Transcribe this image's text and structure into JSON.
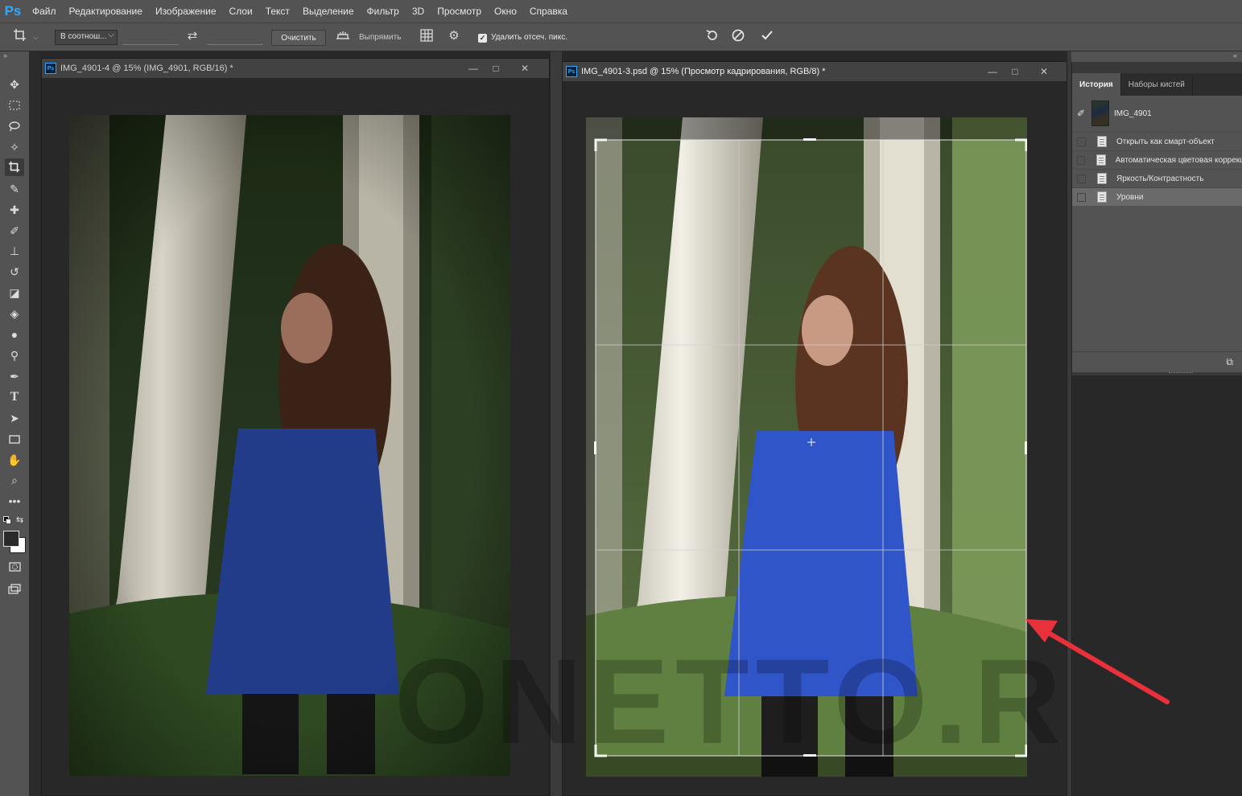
{
  "app": {
    "logo": "Ps"
  },
  "menu": [
    "Файл",
    "Редактирование",
    "Изображение",
    "Слои",
    "Текст",
    "Выделение",
    "Фильтр",
    "3D",
    "Просмотр",
    "Окно",
    "Справка"
  ],
  "options": {
    "crop_icon": "crop-icon",
    "ratio_label": "В соотнош...",
    "clear_label": "Очистить",
    "straighten_label": "Выпрямить",
    "delete_cropped_label": "Удалить отсеч. пикс.",
    "delete_cropped_checked": true
  },
  "tools": [
    "move-icon",
    "marquee-icon",
    "lasso-icon",
    "magic-wand-icon",
    "crop-icon",
    "eyedropper-icon",
    "healing-brush-icon",
    "brush-icon",
    "clone-stamp-icon",
    "history-brush-icon",
    "eraser-icon",
    "paint-bucket-icon",
    "blur-icon",
    "dodge-icon",
    "pen-icon",
    "type-icon",
    "path-selection-icon",
    "rectangle-icon",
    "hand-icon",
    "zoom-icon",
    "more-tools-icon"
  ],
  "documents": [
    {
      "title": "IMG_4901-4 @ 15% (IMG_4901, RGB/16) *",
      "active": false
    },
    {
      "title": "IMG_4901-3.psd @ 15% (Просмотр кадрирования, RGB/8) *",
      "active": true
    }
  ],
  "window_controls": {
    "minimize": "—",
    "maximize": "□",
    "close": "✕"
  },
  "watermark": "ONETTO.RU",
  "panels": {
    "tabs": [
      "История",
      "Наборы кистей"
    ],
    "active_tab": "История",
    "snapshot": {
      "label": "IMG_4901"
    },
    "history": [
      {
        "label": "Открыть как смарт-объект",
        "selected": false
      },
      {
        "label": "Автоматическая цветовая коррекция",
        "selected": false
      },
      {
        "label": "Яркость/Контрастность",
        "selected": false
      },
      {
        "label": "Уровни",
        "selected": true
      }
    ]
  },
  "colors": {
    "accent": "#31a8ff",
    "annotation_arrow": "#e8313a"
  }
}
